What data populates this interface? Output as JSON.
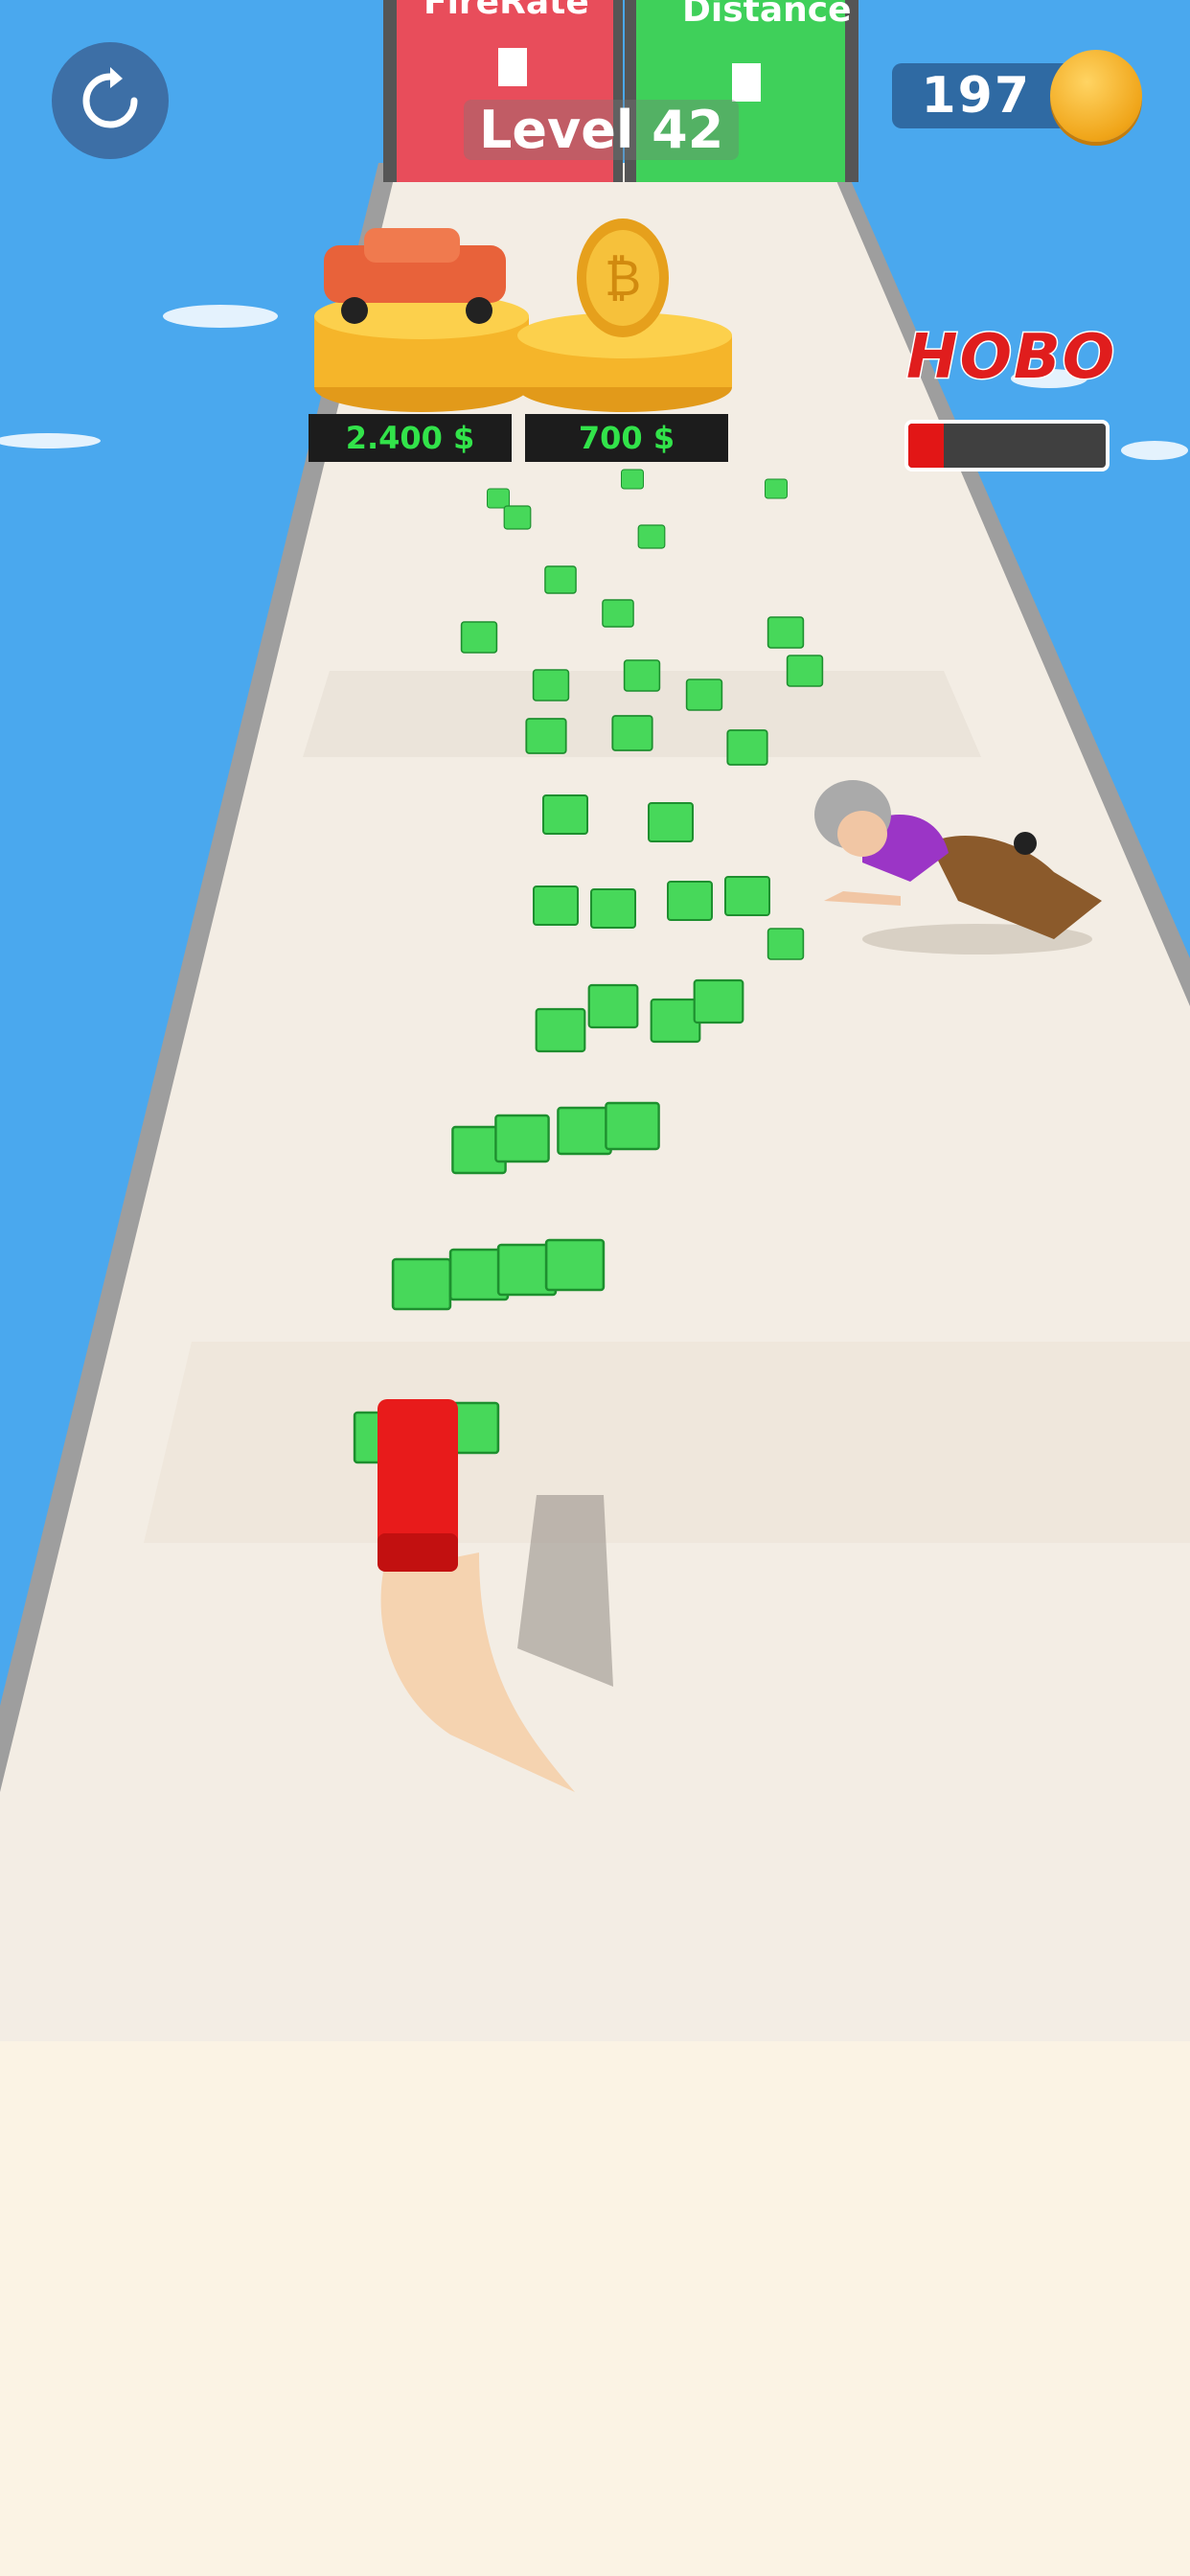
{
  "hud": {
    "level_label": "Level 42",
    "coin_count": "197"
  },
  "gates": {
    "left_label": "FireRate",
    "right_label": "Distance"
  },
  "prizes": {
    "car_price": "2.400 $",
    "coin_price": "700 $"
  },
  "enemy": {
    "name": "HOBO",
    "health_fraction": 0.18
  },
  "colors": {
    "sky": "#4aa8ee",
    "road": "#f3ede4",
    "gate_left": "#e84d5b",
    "gate_right": "#3fd05a",
    "price_text": "#32e34a",
    "enemy_name": "#e01d1d",
    "health_fill": "#e21616"
  }
}
